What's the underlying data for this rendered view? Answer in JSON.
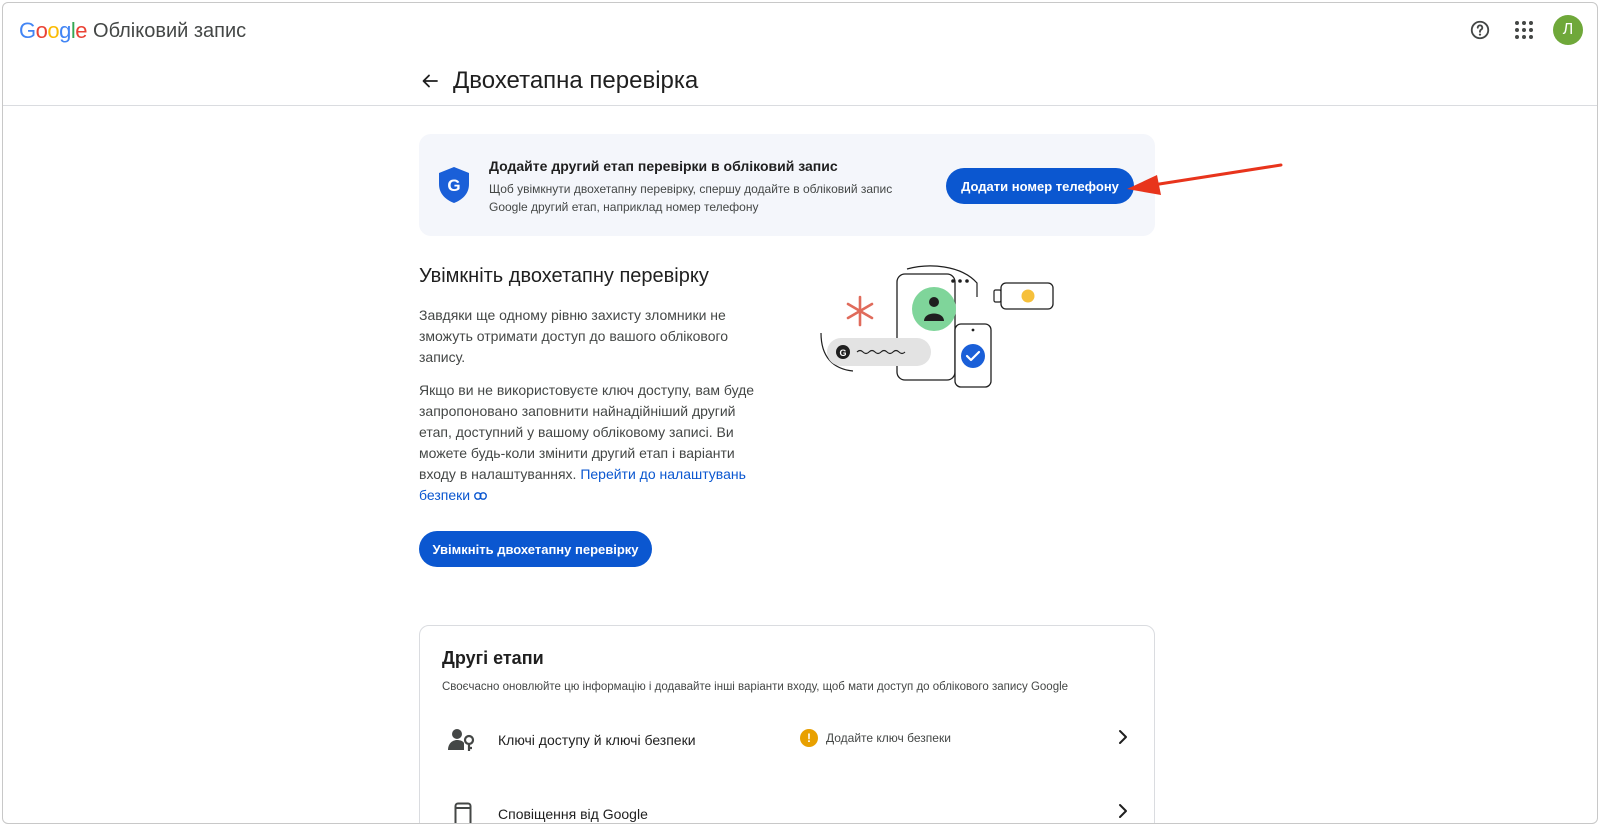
{
  "header": {
    "google_letters": [
      "G",
      "o",
      "o",
      "g",
      "l",
      "e"
    ],
    "google_colors": [
      "#4285f4",
      "#ea4335",
      "#fbbc05",
      "#4285f4",
      "#34a853",
      "#ea4335"
    ],
    "app_name": "Обліковий запис",
    "avatar_letter": "Л",
    "avatar_color": "#6fa83a",
    "icons": [
      "help-icon",
      "apps-grid-icon"
    ]
  },
  "page": {
    "title": "Двохетапна перевірка"
  },
  "banner": {
    "title": "Додайте другий етап перевірки в обліковий запис",
    "description": "Щоб увімкнути двохетапну перевірку, спершу додайте в обліковий запис Google другий етап, наприклад номер телефону",
    "button_label": "Додати номер телефону",
    "shield_letter": "G"
  },
  "section": {
    "title": "Увімкніть двохетапну перевірку",
    "paragraph1": "Завдяки ще одному рівню захисту зломники не зможуть отримати доступ до вашого облікового запису.",
    "paragraph2": "Якщо ви не використовуєте ключ доступу, вам буде запропоновано заповнити найнадійніший другий етап, доступний у вашому обліковому записі. Ви можете будь-коли змінити другий етап і варіанти входу в налаштуваннях.",
    "link_text": "Перейти до налаштувань безпеки",
    "button_label": "Увімкніть двохетапну перевірку"
  },
  "other_steps": {
    "title": "Другі етапи",
    "subtitle": "Своєчасно оновлюйте цю інформацію і додавайте інші варіанти входу, щоб мати доступ до облікового запису Google",
    "rows": [
      {
        "label": "Ключі доступу й ключі безпеки",
        "status": "Додайте ключ безпеки"
      },
      {
        "label": "Сповіщення від Google",
        "status": ""
      }
    ]
  },
  "colors": {
    "accent": "#0b57d0",
    "annotation_arrow": "#e8341c",
    "warning": "#e8a000"
  }
}
